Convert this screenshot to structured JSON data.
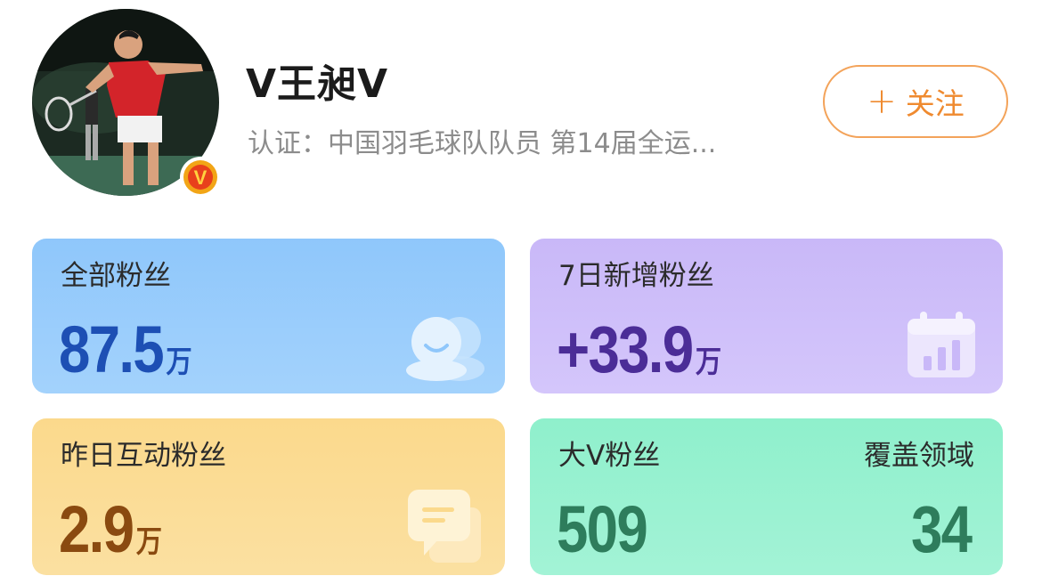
{
  "profile": {
    "name": "V王昶V",
    "certification": "认证：中国羽毛球队队员 第14届全运...",
    "follow_plus": "+",
    "follow_label": "关注",
    "verify_badge_letter": "V"
  },
  "cards": [
    {
      "label": "全部粉丝",
      "value": "87.5",
      "unit": "万",
      "icon": "fans-group-icon",
      "color": "#1d4fb4"
    },
    {
      "label": "7日新增粉丝",
      "value": "+33.9",
      "unit": "万",
      "icon": "calendar-chart-icon",
      "color": "#4b2d97"
    },
    {
      "label": "昨日互动粉丝",
      "value": "2.9",
      "unit": "万",
      "icon": "chat-bubble-icon",
      "color": "#8a4a10"
    },
    {
      "label": "大V粉丝",
      "value": "509",
      "label_right": "覆盖领域",
      "value_right": "34",
      "color": "#2e7d5c"
    }
  ],
  "colors": {
    "follow_accent": "#ef8a2f",
    "verify_badge": "#f2a516"
  }
}
